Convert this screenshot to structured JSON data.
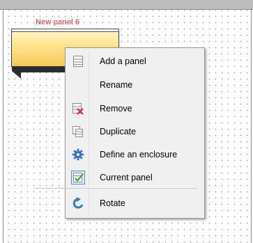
{
  "panel": {
    "name": "New panel  6"
  },
  "context_menu": {
    "items": [
      {
        "label": "Add a panel",
        "icon": "panel-list-icon"
      },
      {
        "label": "Rename",
        "icon": ""
      },
      {
        "label": "Remove",
        "icon": "remove-panel-icon"
      },
      {
        "label": "Duplicate",
        "icon": "duplicate-icon"
      },
      {
        "label": "Define an enclosure",
        "icon": "gear-icon"
      },
      {
        "label": "Current panel",
        "icon": "current-panel-check-icon"
      },
      {
        "label": "Rotate",
        "icon": "rotate-icon"
      }
    ]
  },
  "colors": {
    "panel_name": "#e0302a",
    "menu_background": "#f0f0f0",
    "gear_icon": "#3a6fc4",
    "remove_cross": "#e02a2a",
    "check_green": "#3aa83a"
  }
}
